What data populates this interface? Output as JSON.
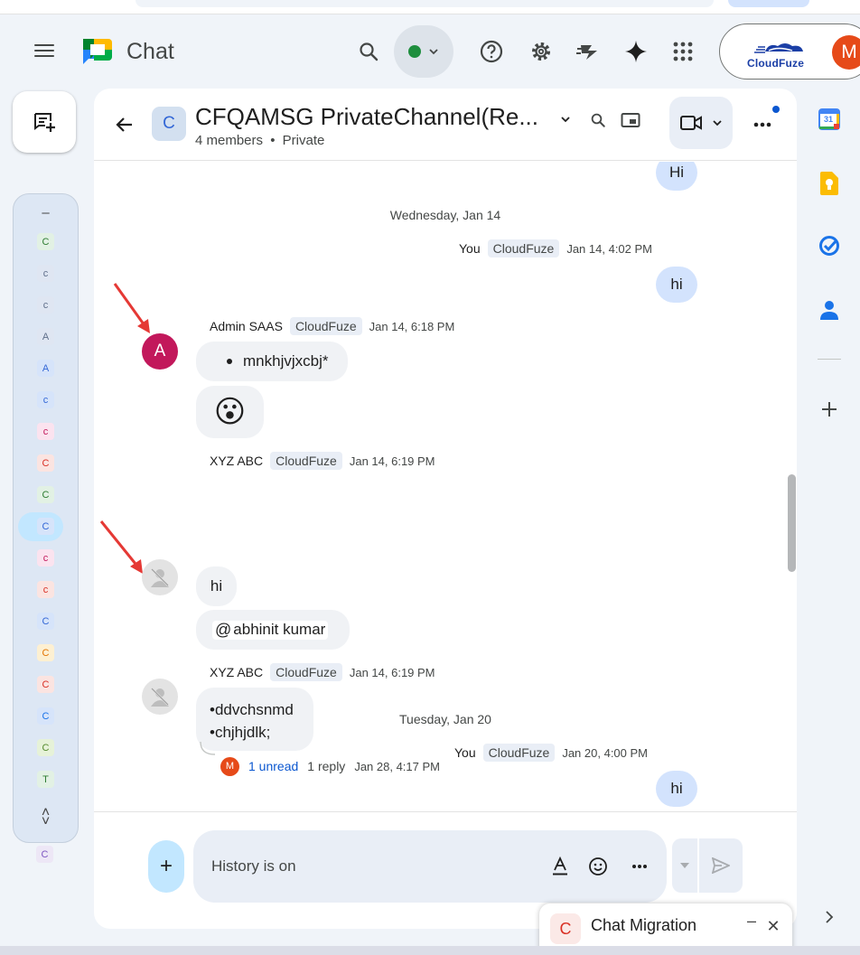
{
  "app": {
    "title": "Chat"
  },
  "account": {
    "org_name": "CloudFuze",
    "avatar_letter": "M"
  },
  "rail": {
    "collapse_symbol": "–",
    "items": [
      {
        "letter": "C",
        "bg": "#e2f1e4",
        "fg": "#2e7d32"
      },
      {
        "letter": "c",
        "bg": "#dfe6f2",
        "fg": "#5f6f8a"
      },
      {
        "letter": "c",
        "bg": "#dfe6f2",
        "fg": "#5f6f8a"
      },
      {
        "letter": "A",
        "bg": "#dfe6f2",
        "fg": "#5f6f8a"
      },
      {
        "letter": "A",
        "bg": "#d6e4fa",
        "fg": "#3367d6"
      },
      {
        "letter": "c",
        "bg": "#d6e4fa",
        "fg": "#3367d6"
      },
      {
        "letter": "c",
        "bg": "#fbe3ef",
        "fg": "#c2185b"
      },
      {
        "letter": "C",
        "bg": "#fbe4e1",
        "fg": "#d93025"
      },
      {
        "letter": "C",
        "bg": "#e2f1e4",
        "fg": "#2e7d32"
      },
      {
        "letter": "C",
        "bg": "#d6e4fa",
        "fg": "#3367d6"
      },
      {
        "letter": "c",
        "bg": "#fbe3ef",
        "fg": "#c2185b"
      },
      {
        "letter": "c",
        "bg": "#fbe4e1",
        "fg": "#d93025"
      },
      {
        "letter": "C",
        "bg": "#d6e4fa",
        "fg": "#3367d6"
      },
      {
        "letter": "C",
        "bg": "#fdf0d2",
        "fg": "#e37400"
      },
      {
        "letter": "C",
        "bg": "#fbe4e1",
        "fg": "#d93025"
      },
      {
        "letter": "C",
        "bg": "#d6e4fa",
        "fg": "#1a73e8"
      },
      {
        "letter": "C",
        "bg": "#e6f2d8",
        "fg": "#558b2f"
      },
      {
        "letter": "T",
        "bg": "#e2f1e4",
        "fg": "#2e7d32"
      }
    ],
    "selected_index": 9,
    "extra_item": "C"
  },
  "space": {
    "avatar_letter": "C",
    "title": "CFQAMSG PrivateChannel(Re...",
    "members": "4 members",
    "separator": "•",
    "visibility": "Private"
  },
  "messages": {
    "top_bubble": "Hi",
    "date1": "Wednesday, Jan 14",
    "you_label": "You",
    "org_tag": "CloudFuze",
    "msg1_time": "Jan 14, 4:02 PM",
    "msg1_text": "hi",
    "admin_name": "Admin SAAS",
    "admin_avatar": "A",
    "admin_time": "Jan 14, 6:18 PM",
    "admin_bullet": "mnkhjvjxcbj*",
    "admin_emoji": "😮",
    "xyz_name": "XYZ ABC",
    "xyz_time1": "Jan 14, 6:19 PM",
    "xyz_text1": "hi",
    "mention_symbol": "@",
    "mention_name": "abhinit kumar",
    "xyz_time2": "Jan 14, 6:19 PM",
    "xyz_line1": "•ddvchsnmd",
    "xyz_line2": "•chjhjdlk;",
    "thread_avatar": "M",
    "thread_unread": "1 unread",
    "thread_replies": "1 reply",
    "thread_time": "Jan 28, 4:17 PM",
    "date2": "Tuesday, Jan 20",
    "msg2_time": "Jan 20, 4:00 PM",
    "msg2_text": "hi"
  },
  "composer": {
    "placeholder": "History is on",
    "add_symbol": "+"
  },
  "popup": {
    "avatar_letter": "C",
    "title": "Chat Migration",
    "minimize": "–",
    "close": "✕"
  },
  "right_rail": {
    "calendar_day": "31"
  },
  "colors": {
    "accent": "#0b57d0",
    "bubble_self": "#d3e3fd",
    "bubble_other": "#f0f2f5",
    "arrow": "#e53935"
  }
}
